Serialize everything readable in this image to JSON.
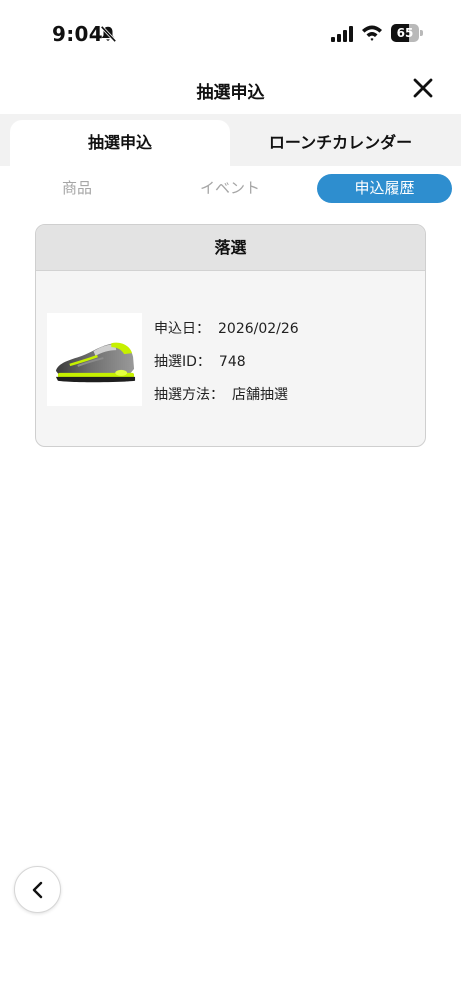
{
  "status_bar": {
    "time": "9:04",
    "battery_level": "65",
    "icons": [
      "bell-slash-icon",
      "signal-icon",
      "wifi-icon",
      "battery-icon"
    ]
  },
  "header": {
    "title": "抽選申込",
    "close_icon": "close-icon"
  },
  "main_tabs": [
    {
      "label": "抽選申込",
      "active": true
    },
    {
      "label": "ローンチカレンダー",
      "active": false
    }
  ],
  "sub_tabs": [
    {
      "label": "商品",
      "active": false
    },
    {
      "label": "イベント",
      "active": false
    },
    {
      "label": "申込履歴",
      "active": true
    }
  ],
  "history": [
    {
      "result": "落選",
      "image": "sneaker-image",
      "rows": [
        {
          "label": "申込日：",
          "value": "2026/02/26"
        },
        {
          "label": "抽選ID：",
          "value": "748"
        },
        {
          "label": "抽選方法：",
          "value": "店舗抽選"
        }
      ]
    }
  ],
  "navigation": {
    "back_icon": "chevron-left-icon"
  },
  "colors": {
    "accent": "#2e8ecf",
    "card_header": "#e3e3e3",
    "tab_bar": "#f2f2f2",
    "inactive_text": "#a6a6a6"
  }
}
